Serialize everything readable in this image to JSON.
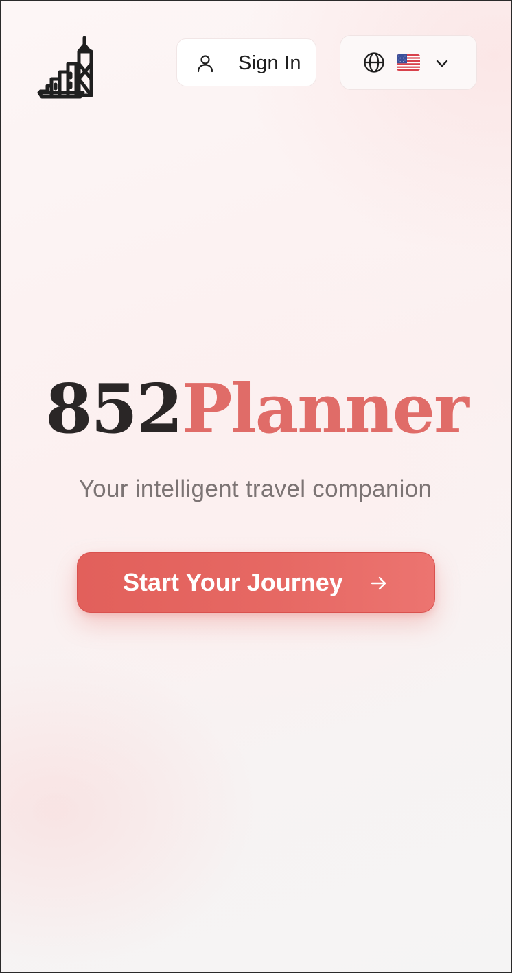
{
  "header": {
    "logo_icon": "hong-kong-skyline-icon",
    "sign_in": {
      "icon": "user-icon",
      "label": "Sign In"
    },
    "language_selector": {
      "globe_icon": "globe-icon",
      "selected_flag": "us-flag-icon",
      "chevron_icon": "chevron-down-icon"
    }
  },
  "hero": {
    "title_part1": "852",
    "title_part2": "Planner",
    "tagline": "Your intelligent travel companion",
    "cta_label": "Start Your Journey",
    "cta_icon": "arrow-right-icon"
  },
  "colors": {
    "accent": "#e2605b",
    "title_dark": "#2a2626",
    "title_accent": "#e06c68",
    "tagline": "#7c7474"
  }
}
